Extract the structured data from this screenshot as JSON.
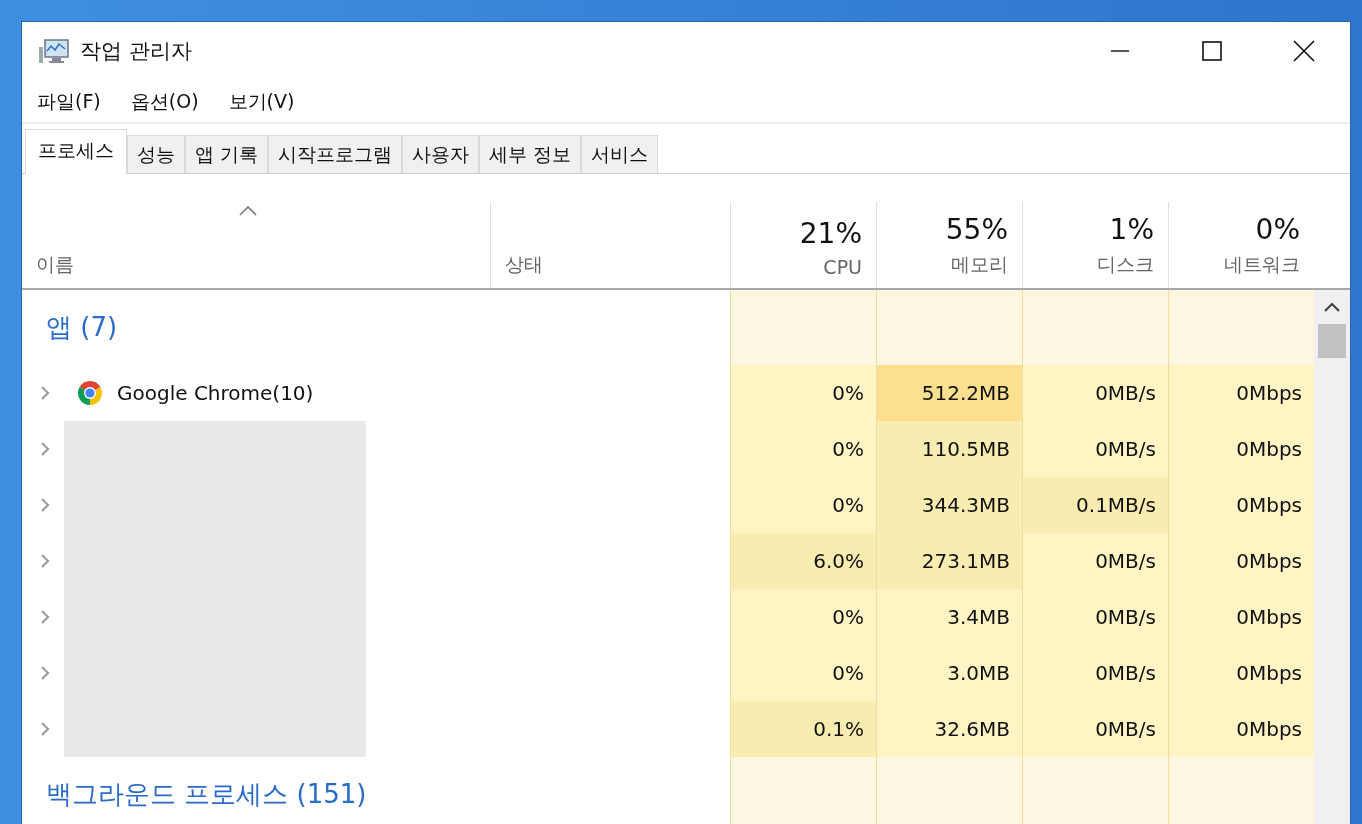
{
  "window": {
    "title": "작업 관리자"
  },
  "menu": [
    {
      "label": "파일(F)"
    },
    {
      "label": "옵션(O)"
    },
    {
      "label": "보기(V)"
    }
  ],
  "tabs": [
    {
      "label": "프로세스",
      "selected": true
    },
    {
      "label": "성능",
      "selected": false
    },
    {
      "label": "앱 기록",
      "selected": false
    },
    {
      "label": "시작프로그램",
      "selected": false
    },
    {
      "label": "사용자",
      "selected": false
    },
    {
      "label": "세부 정보",
      "selected": false
    },
    {
      "label": "서비스",
      "selected": false
    }
  ],
  "columns": [
    {
      "label": "이름",
      "sorted": true
    },
    {
      "label": "상태",
      "sorted": false
    },
    {
      "percent": "21%",
      "label": "CPU",
      "sorted": false
    },
    {
      "percent": "55%",
      "label": "메모리",
      "sorted": false
    },
    {
      "percent": "1%",
      "label": "디스크",
      "sorted": false
    },
    {
      "percent": "0%",
      "label": "네트워크",
      "sorted": false
    }
  ],
  "groups": [
    {
      "title": "앱 (7)",
      "rows": [
        {
          "kind": "browser",
          "name": "Google Chrome(10)",
          "expanded": false,
          "cells": [
            {
              "value": "0%",
              "color": "#fff4c4"
            },
            {
              "value": "512.2MB",
              "color": "#fce08f"
            },
            {
              "value": "0MB/s",
              "color": "#fff4c4"
            },
            {
              "value": "0Mbps",
              "color": "#fff4c4"
            }
          ]
        },
        {
          "kind": "redacted",
          "expanded": false,
          "cells": [
            {
              "value": "0%",
              "color": "#fff4c4"
            },
            {
              "value": "110.5MB",
              "color": "#f9ecb0"
            },
            {
              "value": "0MB/s",
              "color": "#fff4c4"
            },
            {
              "value": "0Mbps",
              "color": "#fff4c4"
            }
          ]
        },
        {
          "kind": "redacted",
          "expanded": false,
          "cells": [
            {
              "value": "0%",
              "color": "#fff4c4"
            },
            {
              "value": "344.3MB",
              "color": "#f9ecb0"
            },
            {
              "value": "0.1MB/s",
              "color": "#f9ecb0"
            },
            {
              "value": "0Mbps",
              "color": "#fff4c4"
            }
          ]
        },
        {
          "kind": "redacted",
          "expanded": false,
          "cells": [
            {
              "value": "6.0%",
              "color": "#f9ecb0"
            },
            {
              "value": "273.1MB",
              "color": "#f9ecb0"
            },
            {
              "value": "0MB/s",
              "color": "#fff4c4"
            },
            {
              "value": "0Mbps",
              "color": "#fff4c4"
            }
          ]
        },
        {
          "kind": "redacted",
          "expanded": false,
          "cells": [
            {
              "value": "0%",
              "color": "#fff4c4"
            },
            {
              "value": "3.4MB",
              "color": "#fff4c4"
            },
            {
              "value": "0MB/s",
              "color": "#fff4c4"
            },
            {
              "value": "0Mbps",
              "color": "#fff4c4"
            }
          ]
        },
        {
          "kind": "redacted",
          "expanded": false,
          "cells": [
            {
              "value": "0%",
              "color": "#fff4c4"
            },
            {
              "value": "3.0MB",
              "color": "#fff4c4"
            },
            {
              "value": "0MB/s",
              "color": "#fff4c4"
            },
            {
              "value": "0Mbps",
              "color": "#fff4c4"
            }
          ]
        },
        {
          "kind": "redacted",
          "expanded": false,
          "cells": [
            {
              "value": "0.1%",
              "color": "#f9ecb0"
            },
            {
              "value": "32.6MB",
              "color": "#fff4c4"
            },
            {
              "value": "0MB/s",
              "color": "#fff4c4"
            },
            {
              "value": "0Mbps",
              "color": "#fff4c4"
            }
          ]
        }
      ]
    },
    {
      "title": "백그라운드 프로세스 (151)"
    }
  ]
}
